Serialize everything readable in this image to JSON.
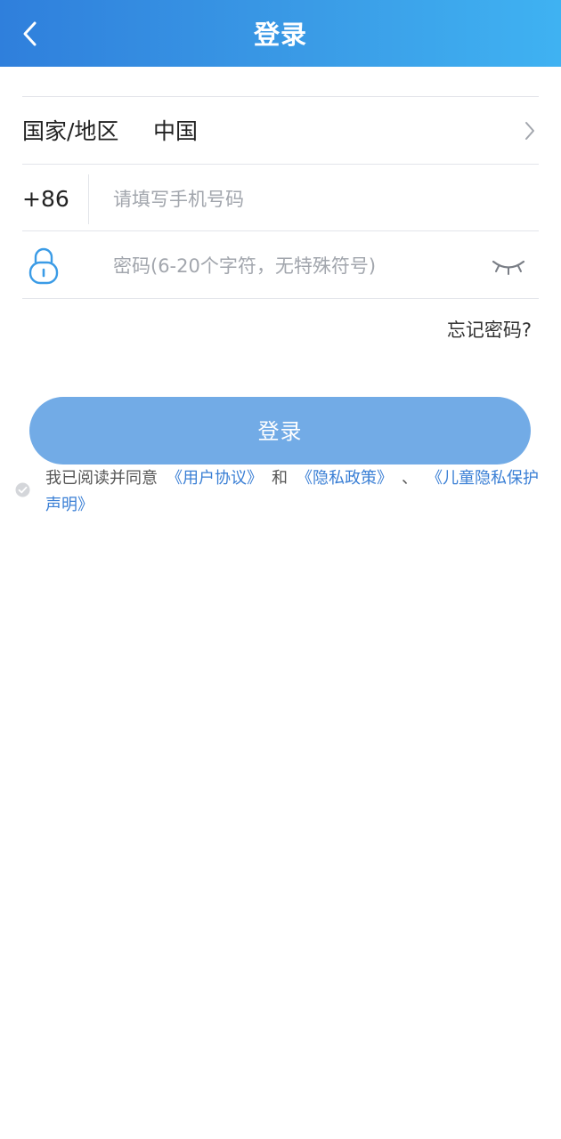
{
  "header": {
    "title": "登录",
    "back_icon": "chevron-left-icon"
  },
  "form": {
    "country_label": "国家/地区",
    "country_value": "中国",
    "phone_code": "+86",
    "phone_placeholder": "请填写手机号码",
    "password_placeholder": "密码(6-20个字符，无特殊符号)",
    "forgot_password": "忘记密码?"
  },
  "login_button": "登录",
  "agreement": {
    "prefix": "我已阅读并同意",
    "user_agreement": "《用户协议》",
    "and": "和",
    "privacy_policy": "《隐私政策》",
    "separator": "、",
    "children_privacy": "《儿童隐私保护声明》"
  },
  "colors": {
    "header_start": "#2f7fdc",
    "header_end": "#3fb2f2",
    "button": "#72abe6",
    "link": "#3a7fd5",
    "icon": "#3a9be6"
  }
}
